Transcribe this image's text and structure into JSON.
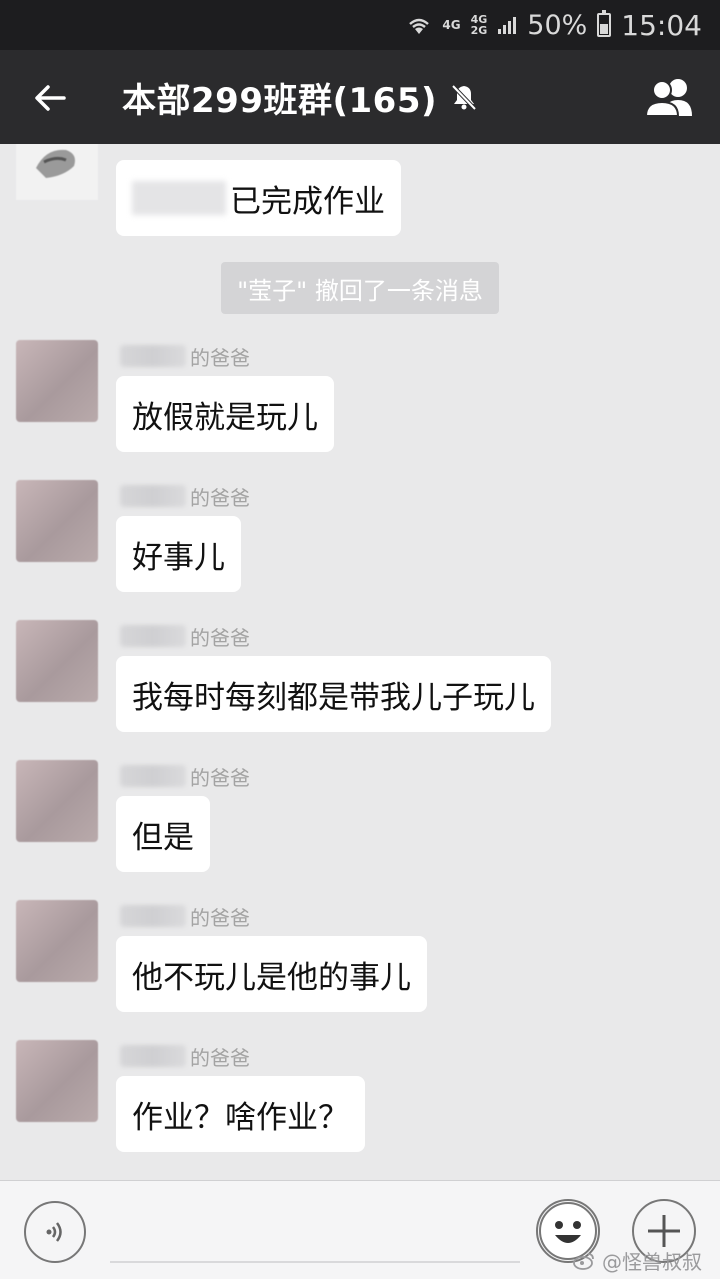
{
  "status_bar": {
    "network_top": "4G",
    "network_stack_top": "4G",
    "network_stack_bottom": "2G",
    "battery": "50%",
    "battery_level": 0.5,
    "time": "15:04"
  },
  "header": {
    "title": "本部299班群(165)",
    "back_icon": "back-arrow-icon",
    "mute_icon": "bell-off-icon",
    "members_icon": "group-members-icon"
  },
  "messages": [
    {
      "sender": "",
      "text": "已完成作业",
      "blurred_prefix": true
    },
    {
      "sender": "的爸爸",
      "text": "放假就是玩儿"
    },
    {
      "sender": "的爸爸",
      "text": "好事儿"
    },
    {
      "sender": "的爸爸",
      "text": "我每时每刻都是带我儿子玩儿"
    },
    {
      "sender": "的爸爸",
      "text": "但是"
    },
    {
      "sender": "的爸爸",
      "text": "他不玩儿是他的事儿"
    },
    {
      "sender": "的爸爸",
      "text": "作业？啥作业？"
    }
  ],
  "system_notice": "\"莹子\" 撤回了一条消息",
  "watermark": "@怪兽叔叔"
}
